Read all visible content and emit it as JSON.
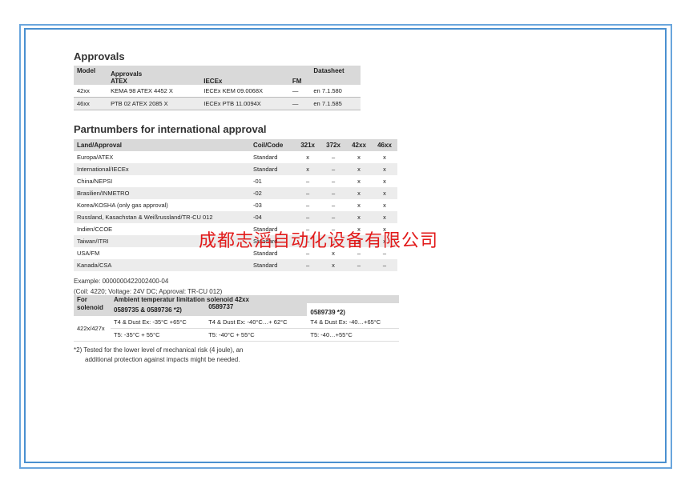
{
  "approvals": {
    "title": "Approvals",
    "headers": {
      "model": "Model",
      "approvals": "Approvals",
      "atex": "ATEX",
      "iecex": "IECEx",
      "fm": "FM",
      "datasheet": "Datasheet"
    },
    "rows": [
      {
        "model": "42xx",
        "atex": "KEMA 98 ATEX 4452 X",
        "iecex": "IECEx KEM 09.0068X",
        "fm": "—",
        "datasheet": "en 7.1.580"
      },
      {
        "model": "46xx",
        "atex": "PTB 02 ATEX 2085 X",
        "iecex": "IECEx PTB 11.0094X",
        "fm": "—",
        "datasheet": "en 7.1.585"
      }
    ]
  },
  "partnumbers": {
    "title": "Partnumbers for international approval",
    "headers": [
      "Land/Approval",
      "Coil/Code",
      "321x",
      "372x",
      "42xx",
      "46xx"
    ],
    "rows": [
      [
        "Europa/ATEX",
        "Standard",
        "x",
        "–",
        "x",
        "x"
      ],
      [
        "International/IECEx",
        "Standard",
        "x",
        "–",
        "x",
        "x"
      ],
      [
        "China/NEPSI",
        "-01",
        "–",
        "–",
        "x",
        "x"
      ],
      [
        "Brasilien/INMETRO",
        "-02",
        "–",
        "–",
        "x",
        "x"
      ],
      [
        "Korea/KOSHA (only gas approval)",
        "-03",
        "–",
        "–",
        "x",
        "x"
      ],
      [
        "Russland, Kasachstan & Weißrussland/TR-CU 012",
        "-04",
        "–",
        "–",
        "x",
        "x"
      ],
      [
        "Indien/CCOE",
        "Standard",
        "–",
        "–",
        "x",
        "x"
      ],
      [
        "Taiwan/ITRI",
        "Standard",
        "–",
        "–",
        "x",
        "x"
      ],
      [
        "USA/FM",
        "Standard",
        "–",
        "x",
        "–",
        "–"
      ],
      [
        "Kanada/CSA",
        "Standard",
        "–",
        "x",
        "–",
        "–"
      ]
    ],
    "example_line1": "Example: 0000000422002400-04",
    "example_line2": "(Coil: 4220; Voltage: 24V DC; Approval: TR-CU 012)"
  },
  "temperature": {
    "header_for": "For solenoid",
    "header_title": "Ambient temperatur limitation solenoid 42xx",
    "col1": "0589735 & 0589736 *2)",
    "col2": "0589737",
    "col3": "0589739 *2)",
    "row_label": "422x/427x",
    "r1c1": "T4 & Dust Ex: -35°C  +65°C",
    "r1c2": "T4 & Dust Ex: -40°C…+ 62°C",
    "r1c3": "T4 & Dust Ex: -40…+65°C",
    "r2c1": "T5: -35°C  + 55°C",
    "r2c2": "T5: -40°C  + 55°C",
    "r2c3": "T5: -40…+55°C"
  },
  "footnote": {
    "line1": "*2) Tested for the lower level of mechanical risk (4 joule), an",
    "line2": "additional protection against impacts might be needed."
  },
  "watermark": "成都志滔自动化设备有限公司",
  "colors": {
    "frame": "#4a90d0",
    "header_bg": "#d9d9d9",
    "watermark": "#e21a1a"
  }
}
